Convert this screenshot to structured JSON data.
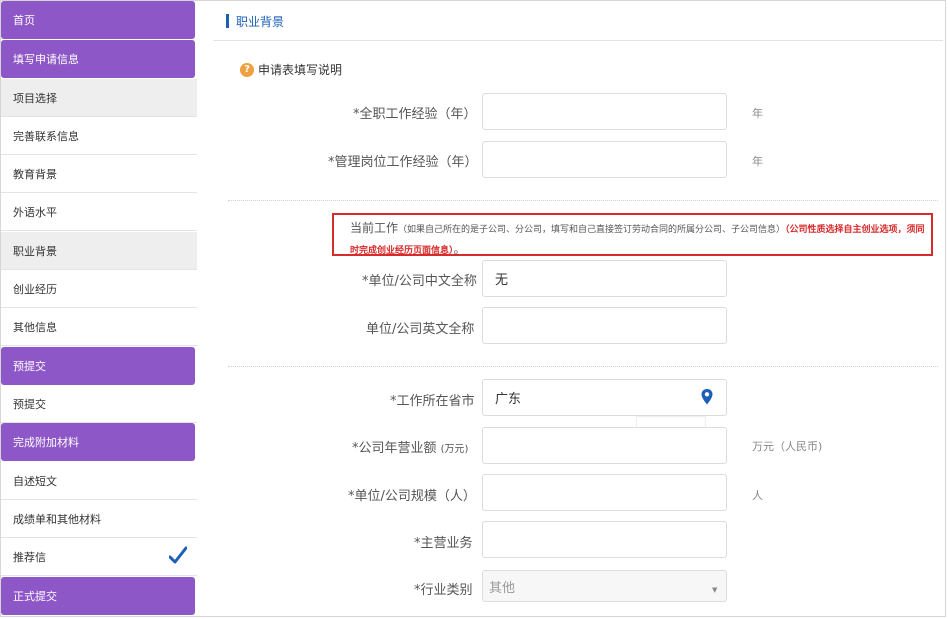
{
  "sidebar": {
    "items": [
      {
        "label": "首页",
        "type": "section"
      },
      {
        "label": "填写申请信息",
        "type": "section"
      },
      {
        "label": "项目选择",
        "type": "sub",
        "active": true
      },
      {
        "label": "完善联系信息",
        "type": "sub"
      },
      {
        "label": "教育背景",
        "type": "sub"
      },
      {
        "label": "外语水平",
        "type": "sub"
      },
      {
        "label": "职业背景",
        "type": "sub",
        "active": true
      },
      {
        "label": "创业经历",
        "type": "sub"
      },
      {
        "label": "其他信息",
        "type": "sub"
      },
      {
        "label": "预提交",
        "type": "section"
      },
      {
        "label": "预提交",
        "type": "sub"
      },
      {
        "label": "完成附加材料",
        "type": "section"
      },
      {
        "label": "自述短文",
        "type": "sub"
      },
      {
        "label": "成绩单和其他材料",
        "type": "sub"
      },
      {
        "label": "推荐信",
        "type": "sub",
        "checked": true
      },
      {
        "label": "正式提交",
        "type": "section"
      }
    ]
  },
  "main": {
    "tab_title": "职业背景",
    "help_text": "申请表填写说明",
    "help_icon": "question-icon",
    "fields": {
      "fulltime_exp": {
        "label": "*全职工作经验（年）",
        "value": "",
        "unit": "年"
      },
      "mgmt_exp": {
        "label": "*管理岗位工作经验（年）",
        "value": "",
        "unit": "年"
      },
      "company_cn": {
        "label": "*单位/公司中文全称",
        "value": "无"
      },
      "company_en": {
        "label": "单位/公司英文全称",
        "value": ""
      },
      "province": {
        "label": "*工作所在省市",
        "value": "广东"
      },
      "revenue": {
        "label": "*公司年营业额",
        "label_small": "(万元)",
        "value": "",
        "unit": "万元（人民币)"
      },
      "scale": {
        "label": "*单位/公司规模（人）",
        "value": "",
        "unit": "人"
      },
      "business": {
        "label": "*主营业务",
        "value": ""
      },
      "industry": {
        "label": "*行业类别",
        "value": "其他"
      }
    },
    "notice": {
      "title": "当前工作",
      "small": "（如果自己所在的是子公司、分公司，填写和自己直接签订劳动合同的所属分公司、子公司信息）",
      "red": "（公司性质选择自主创业选项，须同时完成创业经历页面信息）",
      "end": "。"
    }
  },
  "colors": {
    "purple": "#8e57c7",
    "blue": "#1c5fb7",
    "red": "#d82b2b"
  }
}
